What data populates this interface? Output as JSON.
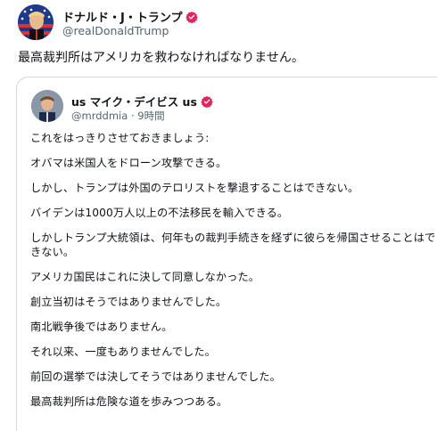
{
  "post": {
    "author_name": "ドナルド・J・トランプ",
    "author_handle": "@realDonaldTrump",
    "text": "最高裁判所はアメリカを救わなければなりません。"
  },
  "quote": {
    "author_name": "us マイク・デイビス us",
    "author_handle": "@mrddmia",
    "separator": "·",
    "time": "9時間",
    "lines": [
      "これをはっきりさせておきましょう:",
      "オバマは米国人をドローン攻撃できる。",
      "しかし、トランプは外国のテロリストを撃退することはできない。",
      "バイデンは1000万人以上の不法移民を輸入できる。",
      "しかしトランプ大統領は、何年もの裁判手続きを経ずに彼らを帰国させることはできない。",
      "アメリカ国民はこれに決して同意しなかった。",
      "創立当初はそうではありませんでした。",
      "南北戦争後ではありません。",
      "それ以来、一度もありませんでした。",
      "前回の選挙では決してそうではありませんでした。",
      "最高裁判所は危険な道を歩みつつある。"
    ]
  },
  "colors": {
    "text": "#0f1419",
    "secondary": "#536471",
    "border": "#cfd9de",
    "badge": "#e0245e"
  },
  "icons": {
    "verified": "verified-badge-icon",
    "avatar_main": "avatar-flag-portrait",
    "avatar_quote": "avatar-portrait"
  }
}
